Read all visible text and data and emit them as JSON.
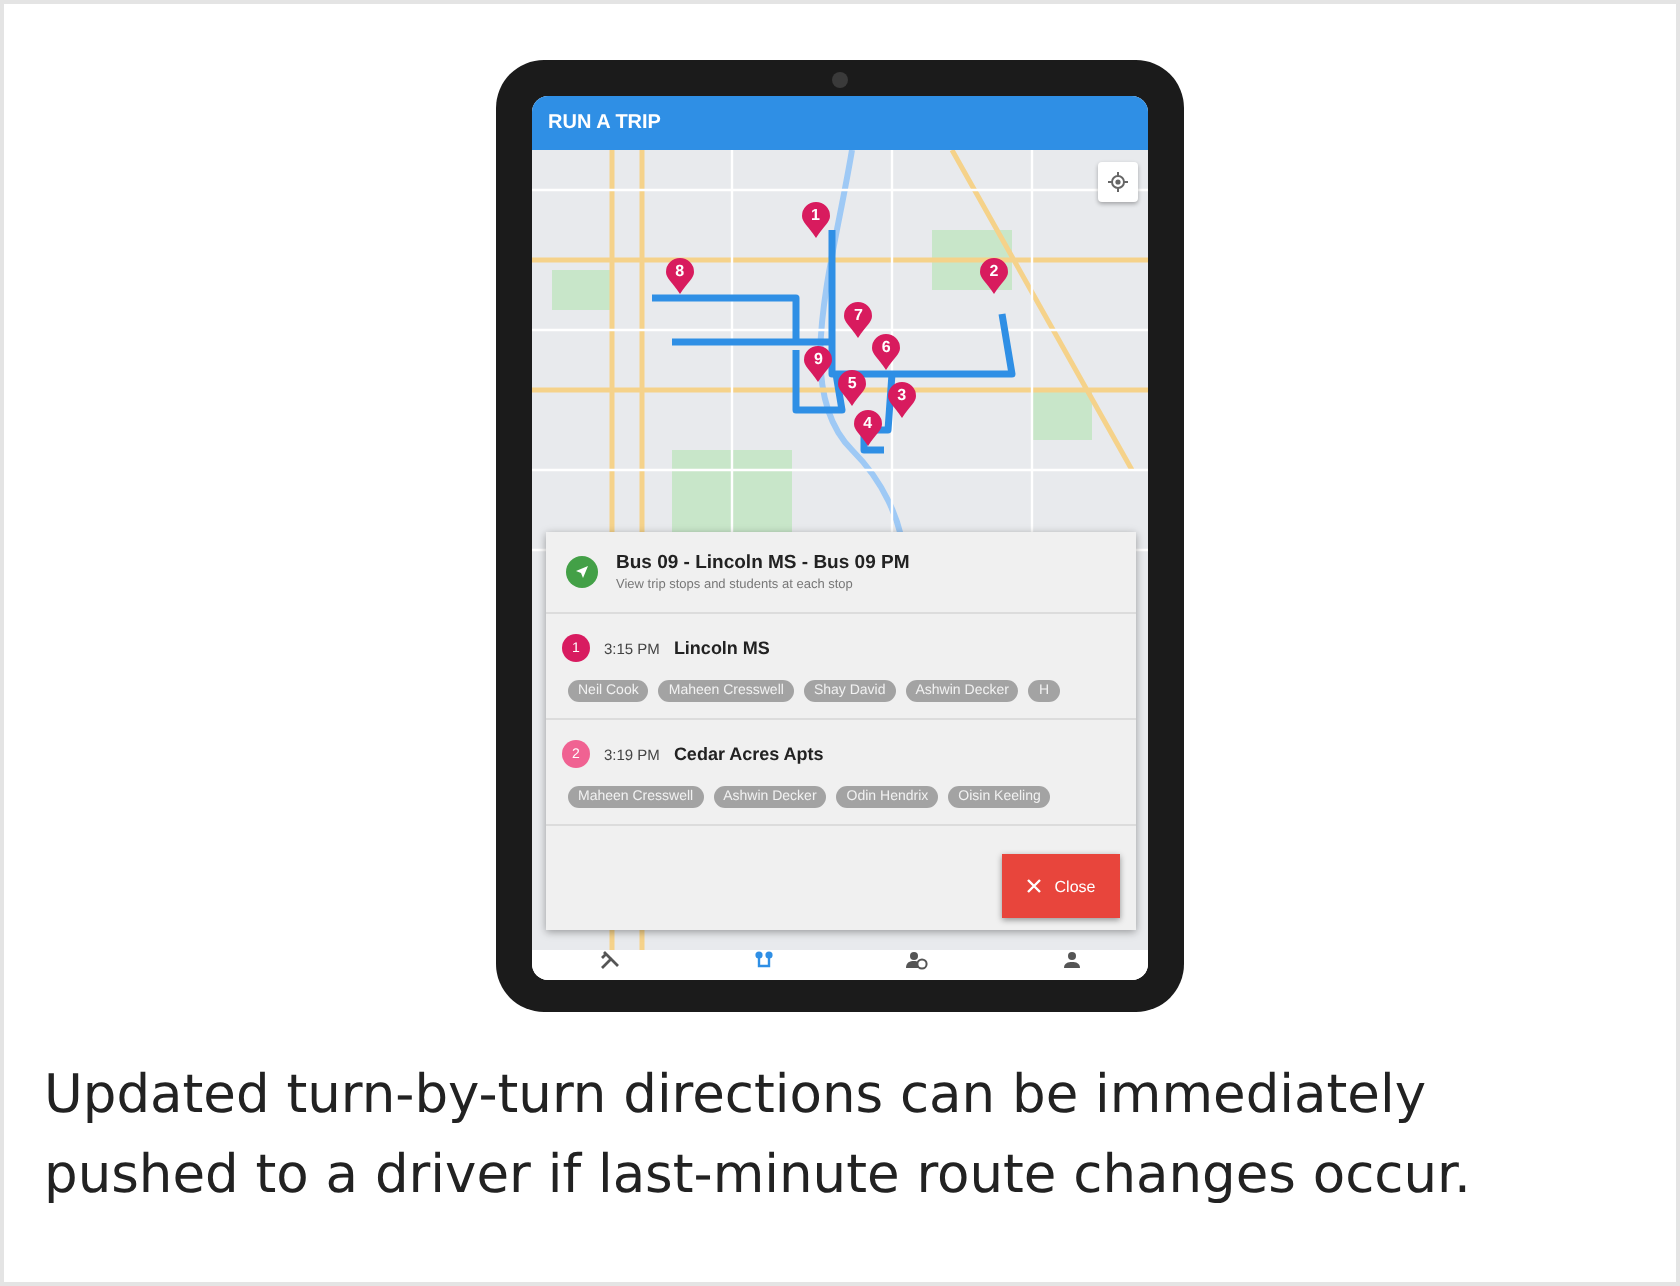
{
  "app_bar": {
    "title": "RUN A TRIP"
  },
  "map": {
    "pins": [
      {
        "label": "1"
      },
      {
        "label": "2"
      },
      {
        "label": "3"
      },
      {
        "label": "4"
      },
      {
        "label": "5"
      },
      {
        "label": "6"
      },
      {
        "label": "7"
      },
      {
        "label": "8"
      },
      {
        "label": "9"
      }
    ]
  },
  "trip_sheet": {
    "title": "Bus 09 - Lincoln MS - Bus 09 PM",
    "subtitle": "View trip stops and students at each stop",
    "stops": [
      {
        "number": "1",
        "color": "#d81b60",
        "time": "3:15 PM",
        "name": "Lincoln MS",
        "students": [
          "Neil Cook",
          "Maheen Cresswell",
          "Shay David",
          "Ashwin Decker",
          "H"
        ]
      },
      {
        "number": "2",
        "color": "#f06292",
        "time": "3:19 PM",
        "name": "Cedar Acres Apts",
        "students": [
          "Maheen Cresswell",
          "Ashwin Decker",
          "Odin Hendrix",
          "Oisin Keeling"
        ]
      }
    ],
    "close_button": "Close"
  },
  "bottom_nav": [
    {
      "kind": "tools",
      "selected": false
    },
    {
      "kind": "route",
      "selected": true
    },
    {
      "kind": "schedule",
      "selected": false
    },
    {
      "kind": "person",
      "selected": false
    }
  ],
  "caption": "Updated turn-by-turn directions can be immediately pushed to a driver if last-minute route changes occur."
}
